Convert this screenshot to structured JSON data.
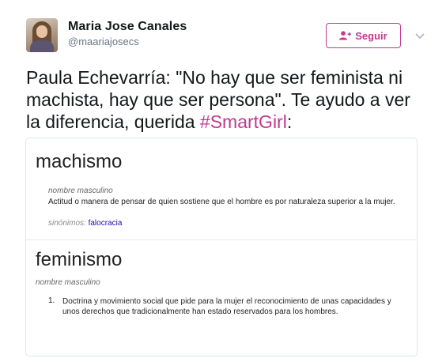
{
  "tweet": {
    "author_name": "Maria Jose Canales",
    "author_handle": "@maariajosecs",
    "follow_label": "Seguir",
    "text_before": "Paula Echevarría: \"No hay que ser feminista ni machista, hay que ser persona\". Te ayudo a ver la diferencia, querida ",
    "hashtag": "#SmartGirl",
    "text_after": ":"
  },
  "card": {
    "entry1": {
      "term": "machismo",
      "part_of_speech": "nombre masculino",
      "definition": "Actitud o manera de pensar de quien sostiene que el hombre es por naturaleza superior a la mujer.",
      "synonyms_label": "sinónimos:",
      "synonym": "falocracia"
    },
    "entry2": {
      "term": "feminismo",
      "part_of_speech": "nombre masculino",
      "number": "1.",
      "definition": "Doctrina y movimiento social que pide para la mujer el reconocimiento de unas capacidades y unos derechos que tradicionalmente han estado reservados para los hombres."
    }
  },
  "colors": {
    "accent": "#c0398f",
    "handle_gray": "#657786",
    "link_blue": "#1a0dab"
  },
  "icons": {
    "follow": "person-add-icon",
    "caret": "chevron-down-icon"
  }
}
